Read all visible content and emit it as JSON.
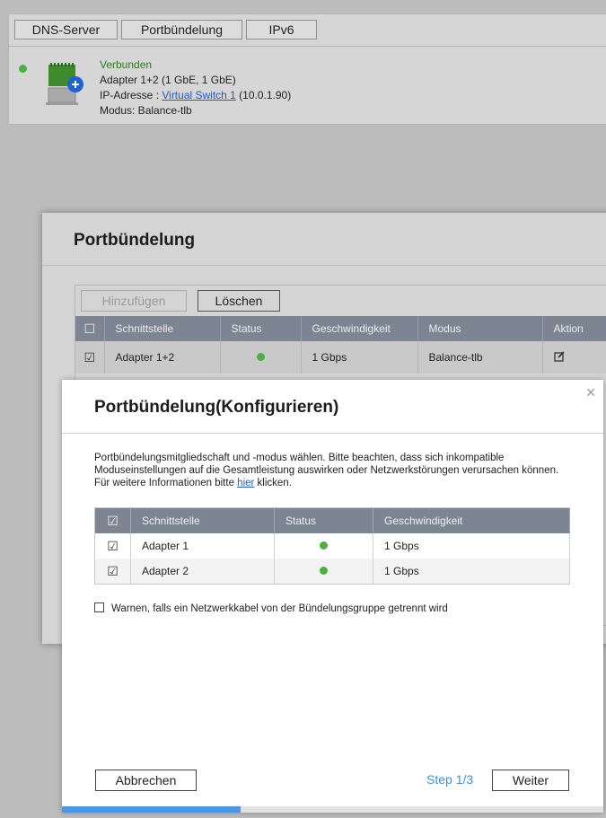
{
  "background_panel": {
    "tabs": [
      "DNS-Server",
      "Portbündelung",
      "IPv6"
    ],
    "status": "Verbunden",
    "adapter": "Adapter 1+2 (1 GbE, 1 GbE)",
    "ip_label": "IP-Adresse : ",
    "ip_link": "Virtual Switch 1",
    "ip_value": " (10.0.1.90)",
    "mode": "Modus: Balance-tlb",
    "status_color": "#4caf3f"
  },
  "bonding_dialog": {
    "title": "Portbündelung",
    "add_button": "Hinzufügen",
    "delete_button": "Löschen",
    "columns": [
      "Schnittstelle",
      "Status",
      "Geschwindigkeit",
      "Modus",
      "Aktion"
    ],
    "rows": [
      {
        "interface": "Adapter 1+2",
        "speed": "1 Gbps",
        "mode": "Balance-tlb",
        "status": "green"
      }
    ],
    "action_icon": "edit-icon"
  },
  "config_dialog": {
    "title": "Portbündelung(Konfigurieren)",
    "description_prefix": "Portbündelungsmitgliedschaft und -modus wählen. Bitte beachten, dass sich inkompatible Moduseinstellungen auf die Gesamtleistung auswirken oder Netzwerkstörungen verursachen können. Für weitere Informationen bitte ",
    "description_link": "hier",
    "description_suffix": " klicken.",
    "columns": [
      "Schnittstelle",
      "Status",
      "Geschwindigkeit"
    ],
    "rows": [
      {
        "interface": "Adapter 1",
        "speed": "1 Gbps",
        "checked": true,
        "status": "green"
      },
      {
        "interface": "Adapter 2",
        "speed": "1 Gbps",
        "checked": true,
        "status": "green"
      }
    ],
    "warn_label": "Warnen, falls ein Netzwerkkabel von der Bündelungsgruppe getrennt wird",
    "cancel_button": "Abbrechen",
    "step_label": "Step 1/3",
    "next_button": "Weiter",
    "progress_fraction": 0.33,
    "accent_color": "#4a97e8"
  }
}
